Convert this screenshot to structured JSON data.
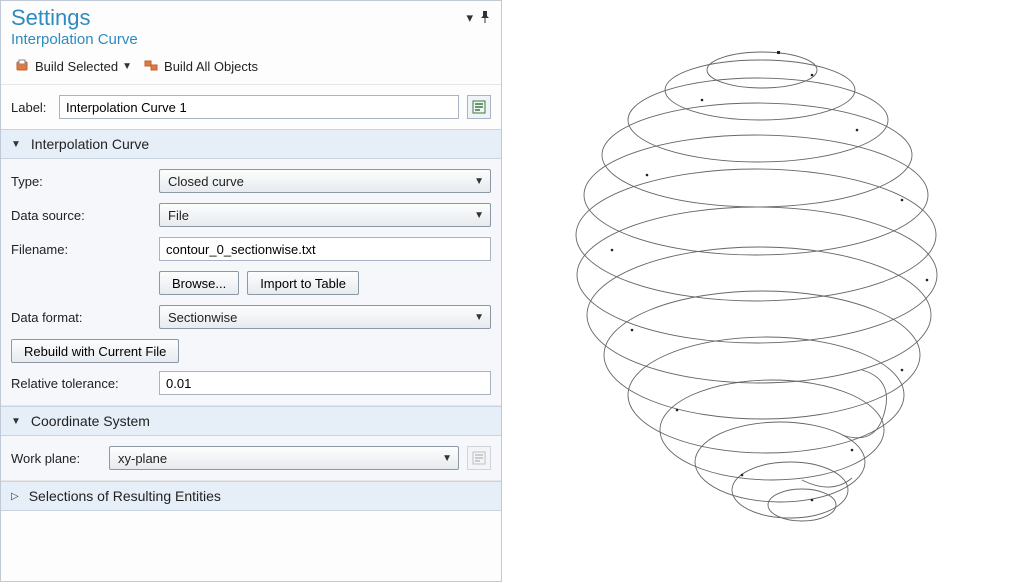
{
  "header": {
    "title": "Settings",
    "subtitle": "Interpolation Curve"
  },
  "toolbar": {
    "build_selected_label": "Build Selected",
    "build_all_label": "Build All Objects"
  },
  "label_row": {
    "caption": "Label:",
    "value": "Interpolation Curve 1"
  },
  "sections": {
    "interp": {
      "title": "Interpolation Curve",
      "type_label": "Type:",
      "type_value": "Closed curve",
      "data_source_label": "Data source:",
      "data_source_value": "File",
      "filename_label": "Filename:",
      "filename_value": "contour_0_sectionwise.txt",
      "browse_label": "Browse...",
      "import_label": "Import to Table",
      "data_format_label": "Data format:",
      "data_format_value": "Sectionwise",
      "rebuild_label": "Rebuild with Current File",
      "rel_tol_label": "Relative tolerance:",
      "rel_tol_value": "0.01"
    },
    "coord": {
      "title": "Coordinate System",
      "work_plane_label": "Work plane:",
      "work_plane_value": "xy-plane"
    },
    "selections": {
      "title": "Selections of Resulting Entities"
    }
  }
}
